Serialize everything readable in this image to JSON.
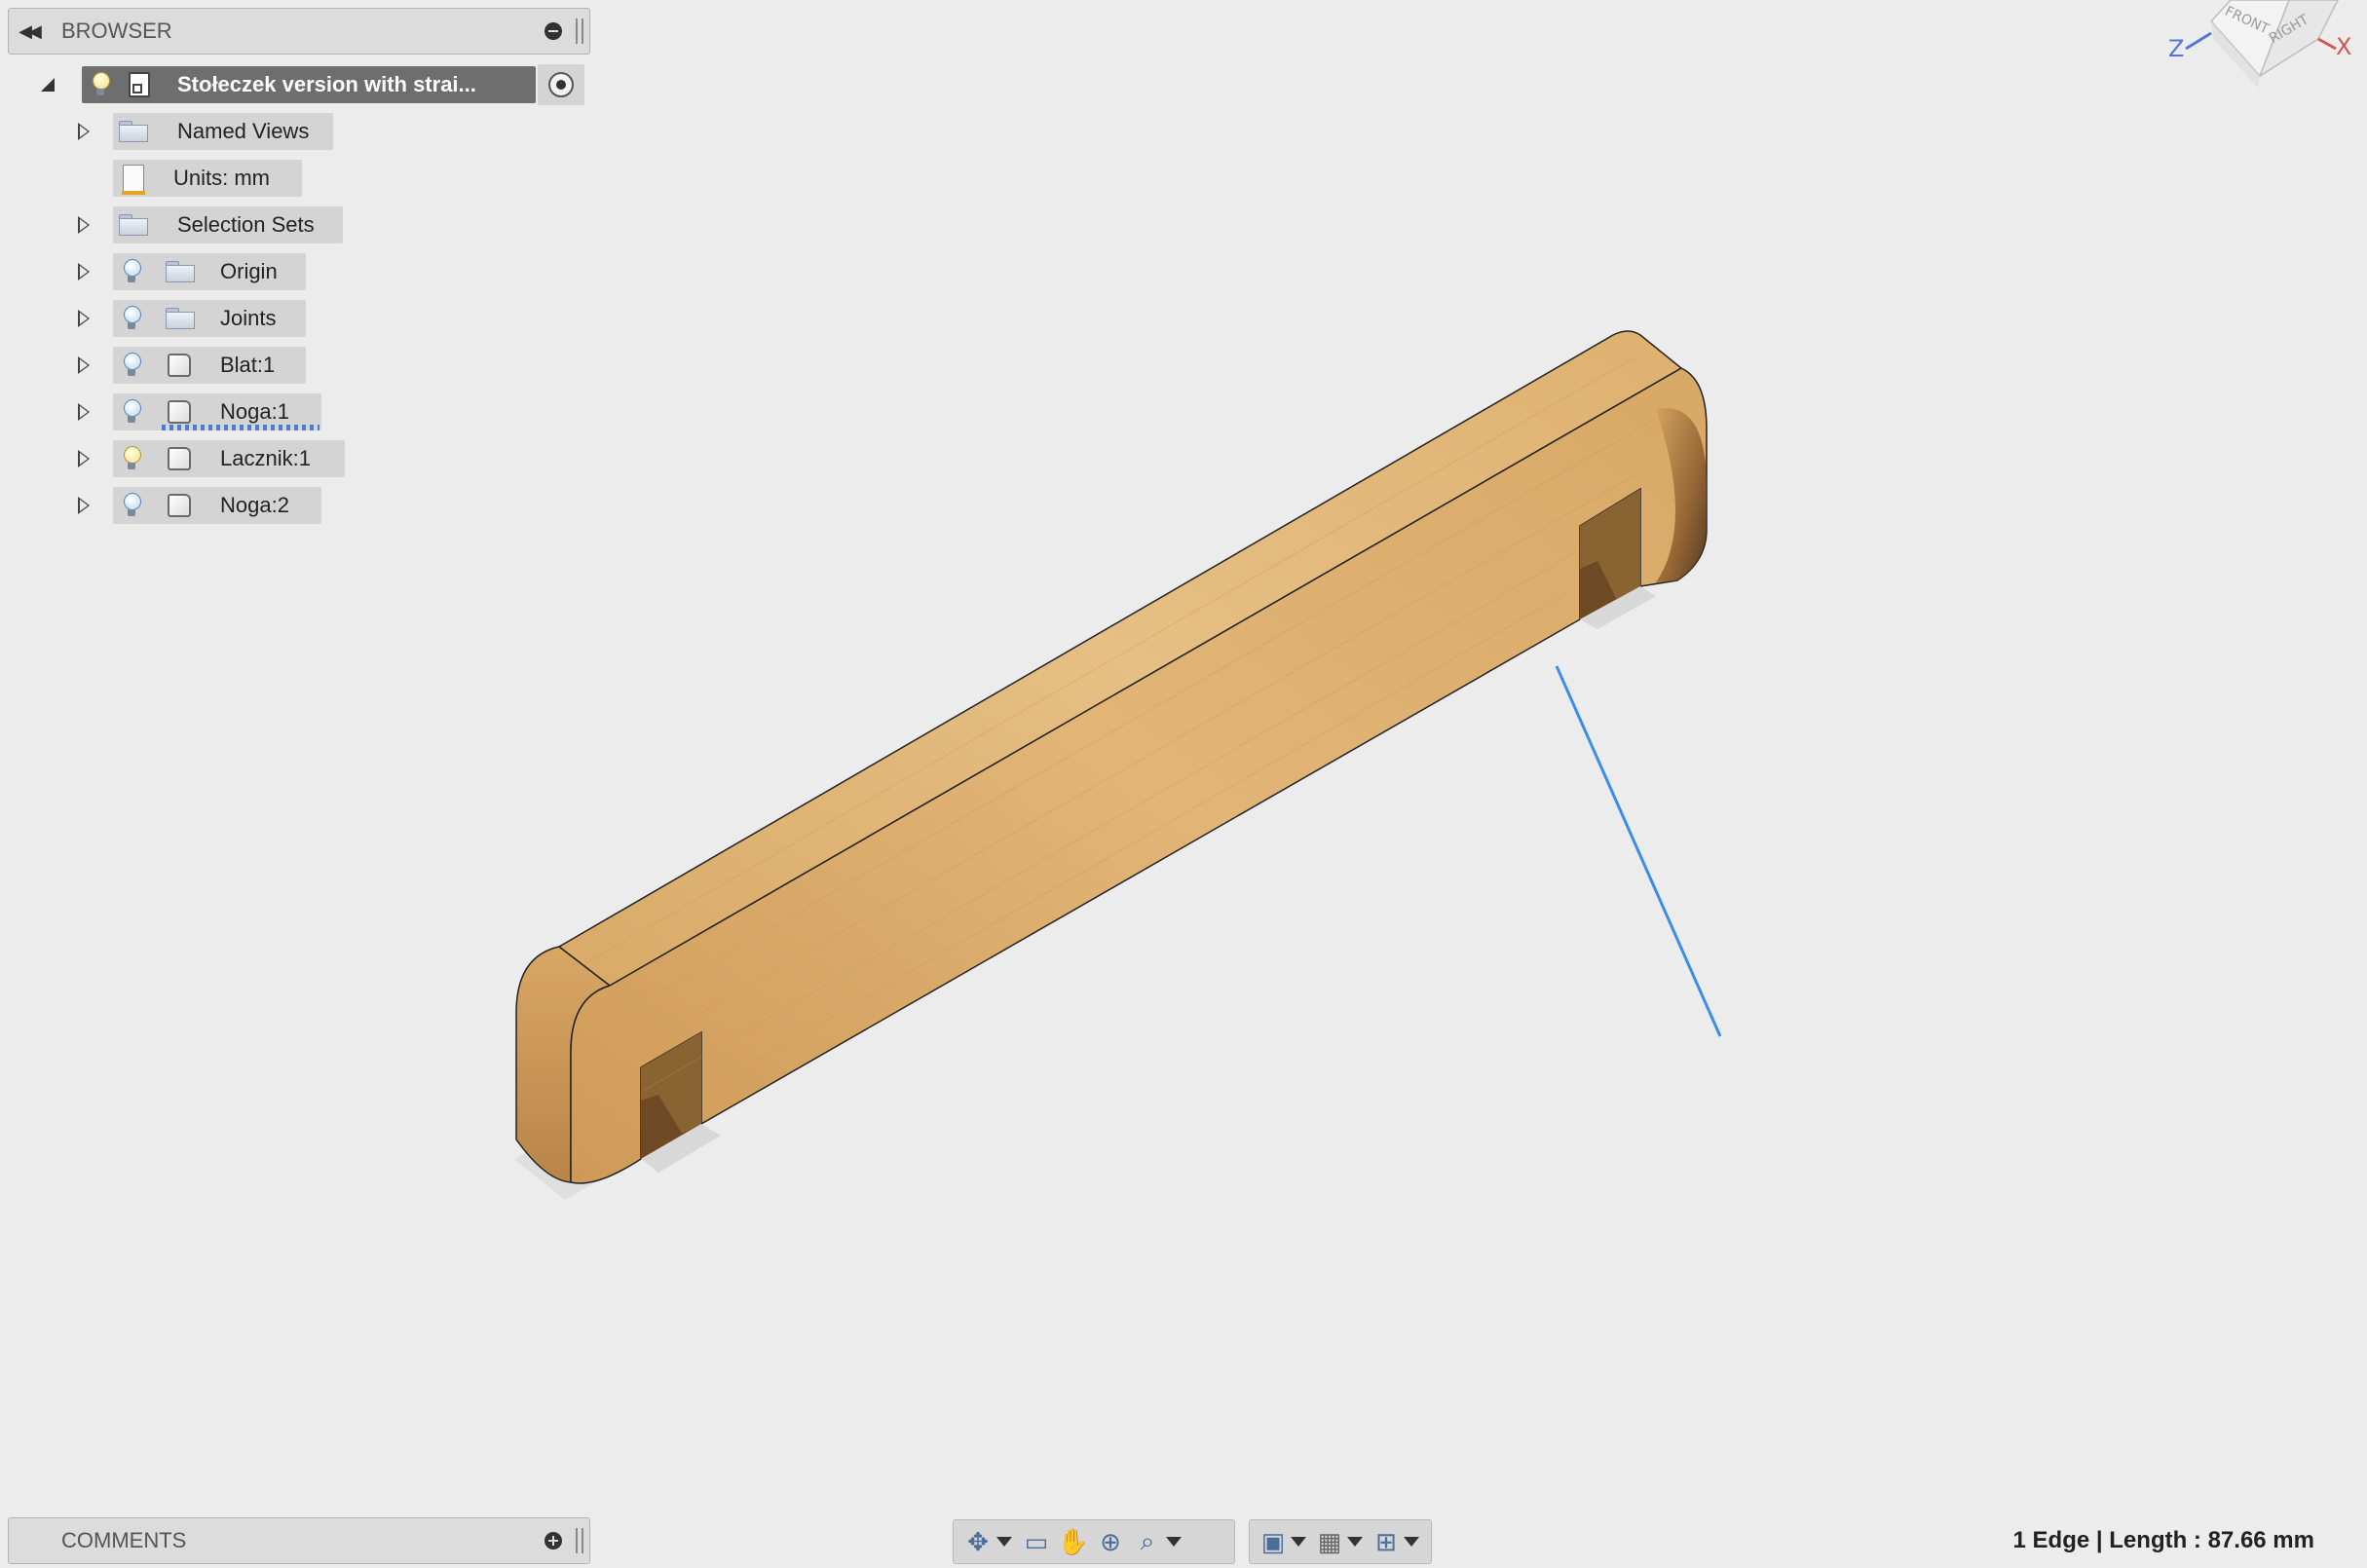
{
  "browser": {
    "title": "BROWSER",
    "root": {
      "label": "Stołeczek version with strai..."
    },
    "items": [
      {
        "label": "Named Views"
      },
      {
        "label": "Units: mm"
      },
      {
        "label": "Selection Sets"
      },
      {
        "label": "Origin"
      },
      {
        "label": "Joints"
      },
      {
        "label": "Blat:1"
      },
      {
        "label": "Noga:1"
      },
      {
        "label": "Lacznik:1"
      },
      {
        "label": "Noga:2"
      }
    ]
  },
  "comments": {
    "title": "COMMENTS"
  },
  "viewcube": {
    "z_label": "Z",
    "x_label": "X",
    "front_label": "FRONT",
    "right_label": "RIGHT"
  },
  "toolbar": {
    "icons": [
      "orbit-icon",
      "look-at-icon",
      "pan-icon",
      "zoom-icon",
      "fit-icon",
      "display-settings-icon",
      "grid-icon",
      "viewports-icon"
    ]
  },
  "status": {
    "selection": "1 Edge | Length : 87.66 mm"
  },
  "colors": {
    "background": "#ececec",
    "selected_edge": "#3b8ee6",
    "root_node": "#6e6e6e",
    "node": "#d4d4d4"
  }
}
